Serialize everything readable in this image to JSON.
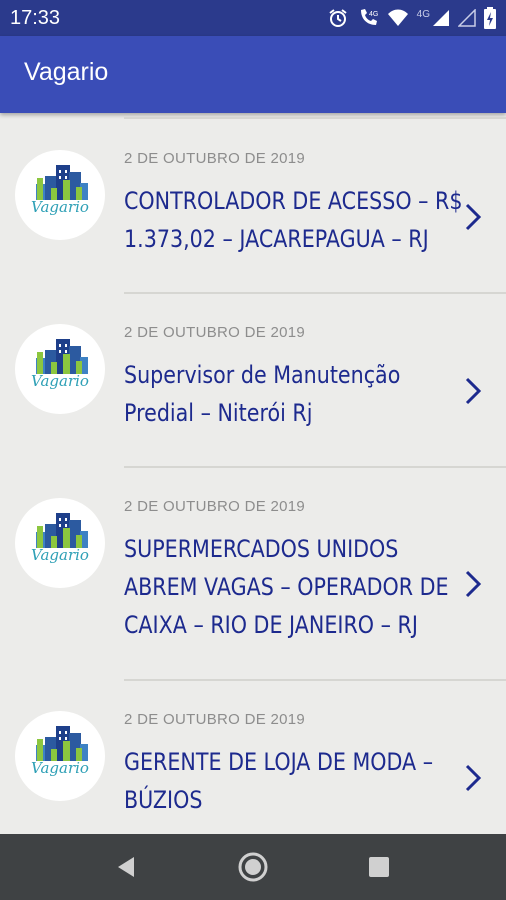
{
  "status_bar": {
    "time": "17:33",
    "net_label": "4G"
  },
  "app_bar": {
    "title": "Vagario"
  },
  "logo_text": "Vagario",
  "items": [
    {
      "date": "2 DE OUTUBRO DE 2019",
      "lines": [
        "CONTROLADOR DE ACESSO – R$",
        "1.373,02 – JACAREPAGUA – RJ"
      ]
    },
    {
      "date": "2 DE OUTUBRO DE 2019",
      "lines": [
        "Supervisor de Manutenção",
        "Predial – Niterói Rj"
      ]
    },
    {
      "date": "2 DE OUTUBRO DE 2019",
      "lines": [
        "SUPERMERCADOS UNIDOS",
        "ABREM VAGAS – OPERADOR DE",
        "CAIXA – RIO DE JANEIRO – RJ"
      ]
    },
    {
      "date": "2 DE OUTUBRO DE 2019",
      "lines": [
        "GERENTE DE LOJA DE MODA –",
        "BÚZIOS"
      ]
    }
  ],
  "icons": {
    "status": [
      "alarm-icon",
      "volte-call-icon",
      "wifi-icon",
      "cell-signal-icon",
      "cell-signal-empty-icon",
      "battery-charging-icon"
    ],
    "logo": "buildings-logo-icon",
    "chevron": "chevron-right-icon",
    "nav": [
      "back-icon",
      "home-icon",
      "recents-icon"
    ]
  },
  "colors": {
    "status_bar": "#2b3a8c",
    "app_bar": "#3a4db7",
    "title_text": "#1d2a8e",
    "date_text": "#8d8d8d",
    "background": "#ececea",
    "nav_bar": "#3f4244"
  }
}
